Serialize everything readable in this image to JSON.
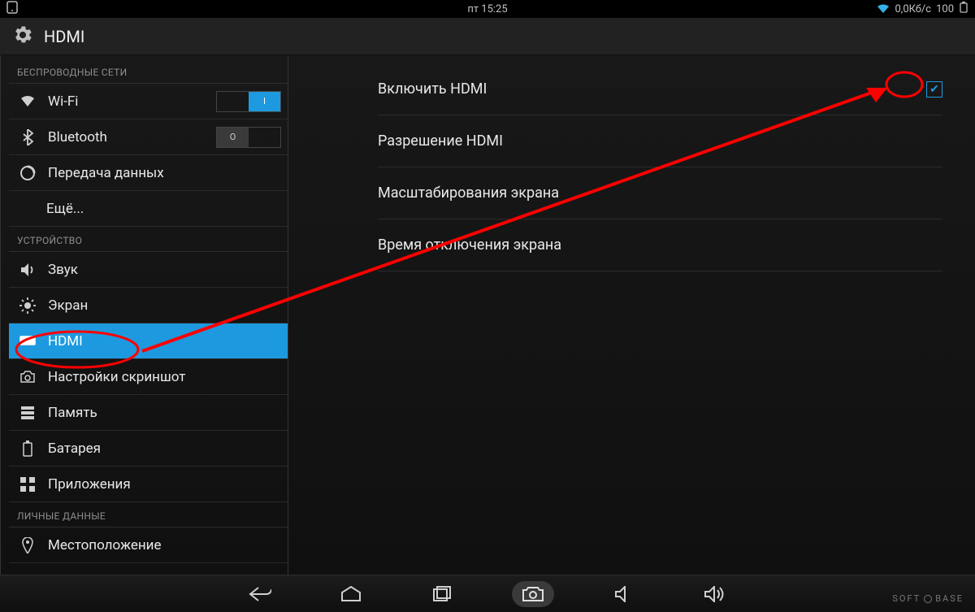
{
  "status": {
    "time": "пт 15:25",
    "net_speed": "0,0Кб/с",
    "battery": "100"
  },
  "appbar": {
    "title": "HDMI"
  },
  "sidebar": {
    "section_wireless": "БЕСПРОВОДНЫЕ СЕТИ",
    "section_device": "УСТРОЙСТВО",
    "section_personal": "ЛИЧНЫЕ ДАННЫЕ",
    "wifi": {
      "label": "Wi-Fi",
      "state": "on",
      "on_text": "I",
      "off_text": ""
    },
    "bluetooth": {
      "label": "Bluetooth",
      "state": "off",
      "on_text": "",
      "off_text": "O"
    },
    "data_usage": {
      "label": "Передача данных"
    },
    "more": {
      "label": "Ещё..."
    },
    "sound": {
      "label": "Звук"
    },
    "display": {
      "label": "Экран"
    },
    "hdmi": {
      "label": "HDMI"
    },
    "screenshot": {
      "label": "Настройки скриншот"
    },
    "storage": {
      "label": "Память"
    },
    "battery": {
      "label": "Батарея"
    },
    "apps": {
      "label": "Приложения"
    },
    "location": {
      "label": "Местоположение"
    }
  },
  "content": {
    "enable_hdmi": {
      "label": "Включить HDMI",
      "checked": true
    },
    "resolution": {
      "label": "Разрешение HDMI"
    },
    "scaling": {
      "label": "Масштабирования экрана"
    },
    "screen_timeout": {
      "label": "Время отключения экрана"
    }
  },
  "watermark": {
    "left": "SOFT",
    "right": "BASE"
  }
}
